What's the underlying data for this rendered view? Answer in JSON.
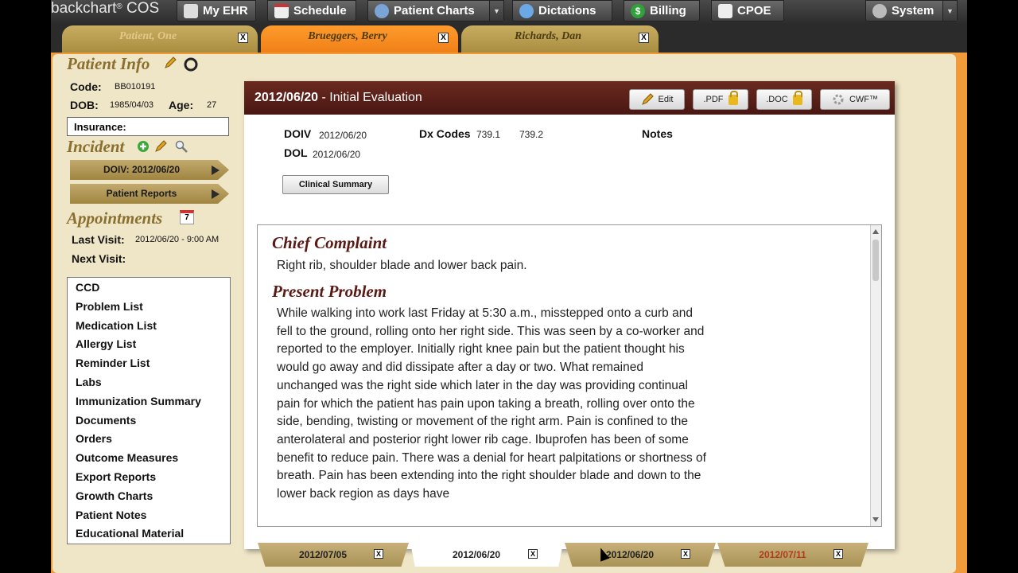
{
  "nav": {
    "logo": "backchart",
    "logo_sup": "®",
    "logo_suffix": "COS",
    "buttons": [
      {
        "label": "My EHR",
        "icon": "home-icon"
      },
      {
        "label": "Schedule",
        "icon": "calendar-icon"
      },
      {
        "label": "Patient Charts",
        "icon": "patient-icon"
      },
      {
        "label": "Dictations",
        "icon": "speech-bubble-icon"
      },
      {
        "label": "Billing",
        "icon": "dollar-icon"
      },
      {
        "label": "CPOE",
        "icon": "pencil-paper-icon"
      },
      {
        "label": "System",
        "icon": "gear-icon"
      }
    ]
  },
  "patient_tabs": [
    {
      "label": "Patient, One"
    },
    {
      "label": "Brueggers, Berry"
    },
    {
      "label": "Richards, Dan"
    }
  ],
  "tab_close": "X",
  "patient_info": {
    "title": "Patient Info",
    "code_label": "Code:",
    "code": "BB010191",
    "dob_label": "DOB:",
    "dob": "1985/04/03",
    "age_label": "Age:",
    "age": "27",
    "insurance_label": "Insurance:"
  },
  "incident": {
    "title": "Incident",
    "doiv_button": "DOIV: 2012/06/20",
    "reports_button": "Patient Reports"
  },
  "appointments": {
    "title": "Appointments",
    "calendar_day": "7",
    "last_visit_label": "Last Visit:",
    "last_visit": "2012/06/20 - 9:00 AM",
    "next_visit_label": "Next Visit:"
  },
  "menu": [
    "CCD",
    "Problem List",
    "Medication List",
    "Allergy List",
    "Reminder List",
    "Labs",
    "Immunization Summary",
    "Documents",
    "Orders",
    "Outcome Measures",
    "Export Reports",
    "Growth Charts",
    "Patient Notes",
    "Educational Material"
  ],
  "panel": {
    "date": "2012/06/20",
    "title_suffix": " - Initial Evaluation",
    "edit": "Edit",
    "pdf": ".PDF",
    "doc": ".DOC",
    "cwf": "CWF™",
    "doiv_label": "DOIV",
    "doiv": "2012/06/20",
    "dol_label": "DOL",
    "dol": "2012/06/20",
    "dx_label": "Dx Codes",
    "dx1": "739.1",
    "dx2": "739.2",
    "notes_label": "Notes",
    "clinical_summary": "Clinical Summary"
  },
  "document": {
    "h1": "Chief Complaint",
    "p1": "Right rib, shoulder blade and lower back pain.",
    "h2": "Present Problem",
    "p2": "While walking into work last Friday at 5:30 a.m., misstepped onto a curb and fell to the ground, rolling onto her right side. This was seen by a co-worker and reported to the employer. Initially right knee pain but the patient thought his would go away and did dissipate after a day or two. What remained unchanged was the right side which later in the day was providing continual pain for which the patient has pain upon taking a breath, rolling over onto the side, bending, twisting or movement of the right arm. Pain is confined to the anterolateral and posterior right lower rib cage. Ibuprofen has been of some benefit to reduce pain. There was a denial for heart palpitations or shortness of breath. Pain has been extending into the right shoulder blade and down to the lower back region as days have"
  },
  "visit_tabs": [
    {
      "label": "2012/07/05"
    },
    {
      "label": "2012/06/20"
    },
    {
      "label": "2012/06/20"
    },
    {
      "label": "2012/07/11"
    }
  ],
  "colors": {
    "accent": "#f08018",
    "header": "#4a1712",
    "section_title": "#8a6f2e"
  }
}
